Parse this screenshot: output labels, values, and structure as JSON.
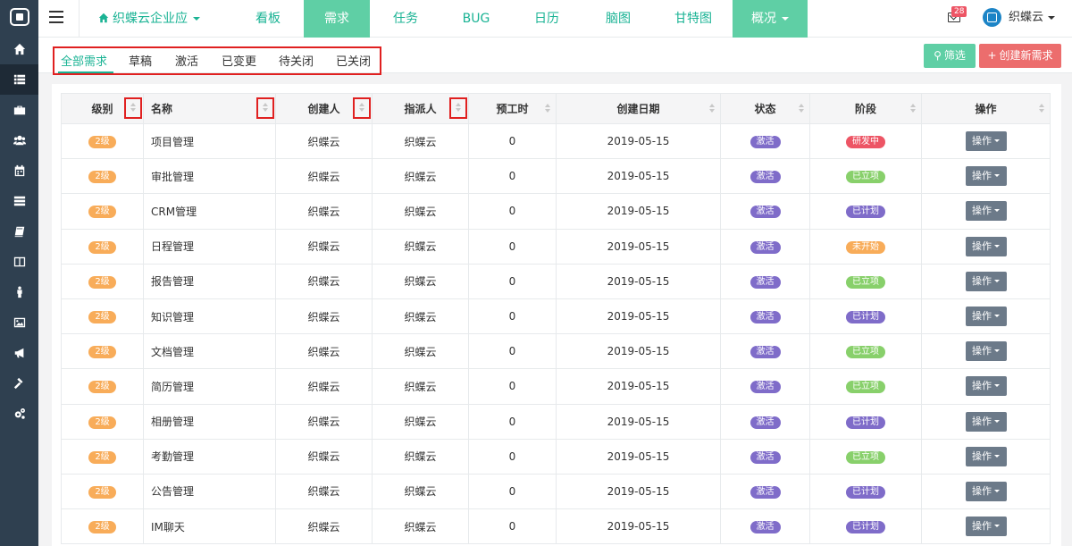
{
  "header": {
    "project": "织蝶云企业应",
    "tabs": [
      "看板",
      "需求",
      "任务",
      "BUG",
      "日历",
      "脑图",
      "甘特图",
      "概况"
    ],
    "mail_badge": "28",
    "user_name": "织蝶云"
  },
  "subtabs": [
    "全部需求",
    "草稿",
    "激活",
    "已变更",
    "待关闭",
    "已关闭"
  ],
  "buttons": {
    "filter": "筛选",
    "create": "创建新需求"
  },
  "table": {
    "columns": [
      "级别",
      "名称",
      "创建人",
      "指派人",
      "预工时",
      "创建日期",
      "状态",
      "阶段",
      "操作"
    ],
    "op_label": "操作",
    "rows": [
      {
        "level": "2级",
        "name": "项目管理",
        "creator": "织蝶云",
        "assignee": "织蝶云",
        "hours": "0",
        "date": "2019-05-15",
        "state": "激活",
        "stage": "研发中",
        "stage_kind": "dev"
      },
      {
        "level": "2级",
        "name": "审批管理",
        "creator": "织蝶云",
        "assignee": "织蝶云",
        "hours": "0",
        "date": "2019-05-15",
        "state": "激活",
        "stage": "已立项",
        "stage_kind": "set"
      },
      {
        "level": "2级",
        "name": "CRM管理",
        "creator": "织蝶云",
        "assignee": "织蝶云",
        "hours": "0",
        "date": "2019-05-15",
        "state": "激活",
        "stage": "已计划",
        "stage_kind": "plan"
      },
      {
        "level": "2级",
        "name": "日程管理",
        "creator": "织蝶云",
        "assignee": "织蝶云",
        "hours": "0",
        "date": "2019-05-15",
        "state": "激活",
        "stage": "未开始",
        "stage_kind": "wait"
      },
      {
        "level": "2级",
        "name": "报告管理",
        "creator": "织蝶云",
        "assignee": "织蝶云",
        "hours": "0",
        "date": "2019-05-15",
        "state": "激活",
        "stage": "已立项",
        "stage_kind": "set"
      },
      {
        "level": "2级",
        "name": "知识管理",
        "creator": "织蝶云",
        "assignee": "织蝶云",
        "hours": "0",
        "date": "2019-05-15",
        "state": "激活",
        "stage": "已计划",
        "stage_kind": "plan"
      },
      {
        "level": "2级",
        "name": "文档管理",
        "creator": "织蝶云",
        "assignee": "织蝶云",
        "hours": "0",
        "date": "2019-05-15",
        "state": "激活",
        "stage": "已立项",
        "stage_kind": "set"
      },
      {
        "level": "2级",
        "name": "简历管理",
        "creator": "织蝶云",
        "assignee": "织蝶云",
        "hours": "0",
        "date": "2019-05-15",
        "state": "激活",
        "stage": "已立项",
        "stage_kind": "set"
      },
      {
        "level": "2级",
        "name": "相册管理",
        "creator": "织蝶云",
        "assignee": "织蝶云",
        "hours": "0",
        "date": "2019-05-15",
        "state": "激活",
        "stage": "已计划",
        "stage_kind": "plan"
      },
      {
        "level": "2级",
        "name": "考勤管理",
        "creator": "织蝶云",
        "assignee": "织蝶云",
        "hours": "0",
        "date": "2019-05-15",
        "state": "激活",
        "stage": "已立项",
        "stage_kind": "set"
      },
      {
        "level": "2级",
        "name": "公告管理",
        "creator": "织蝶云",
        "assignee": "织蝶云",
        "hours": "0",
        "date": "2019-05-15",
        "state": "激活",
        "stage": "已计划",
        "stage_kind": "plan"
      },
      {
        "level": "2级",
        "name": "IM聊天",
        "creator": "织蝶云",
        "assignee": "织蝶云",
        "hours": "0",
        "date": "2019-05-15",
        "state": "激活",
        "stage": "已计划",
        "stage_kind": "plan"
      }
    ]
  }
}
